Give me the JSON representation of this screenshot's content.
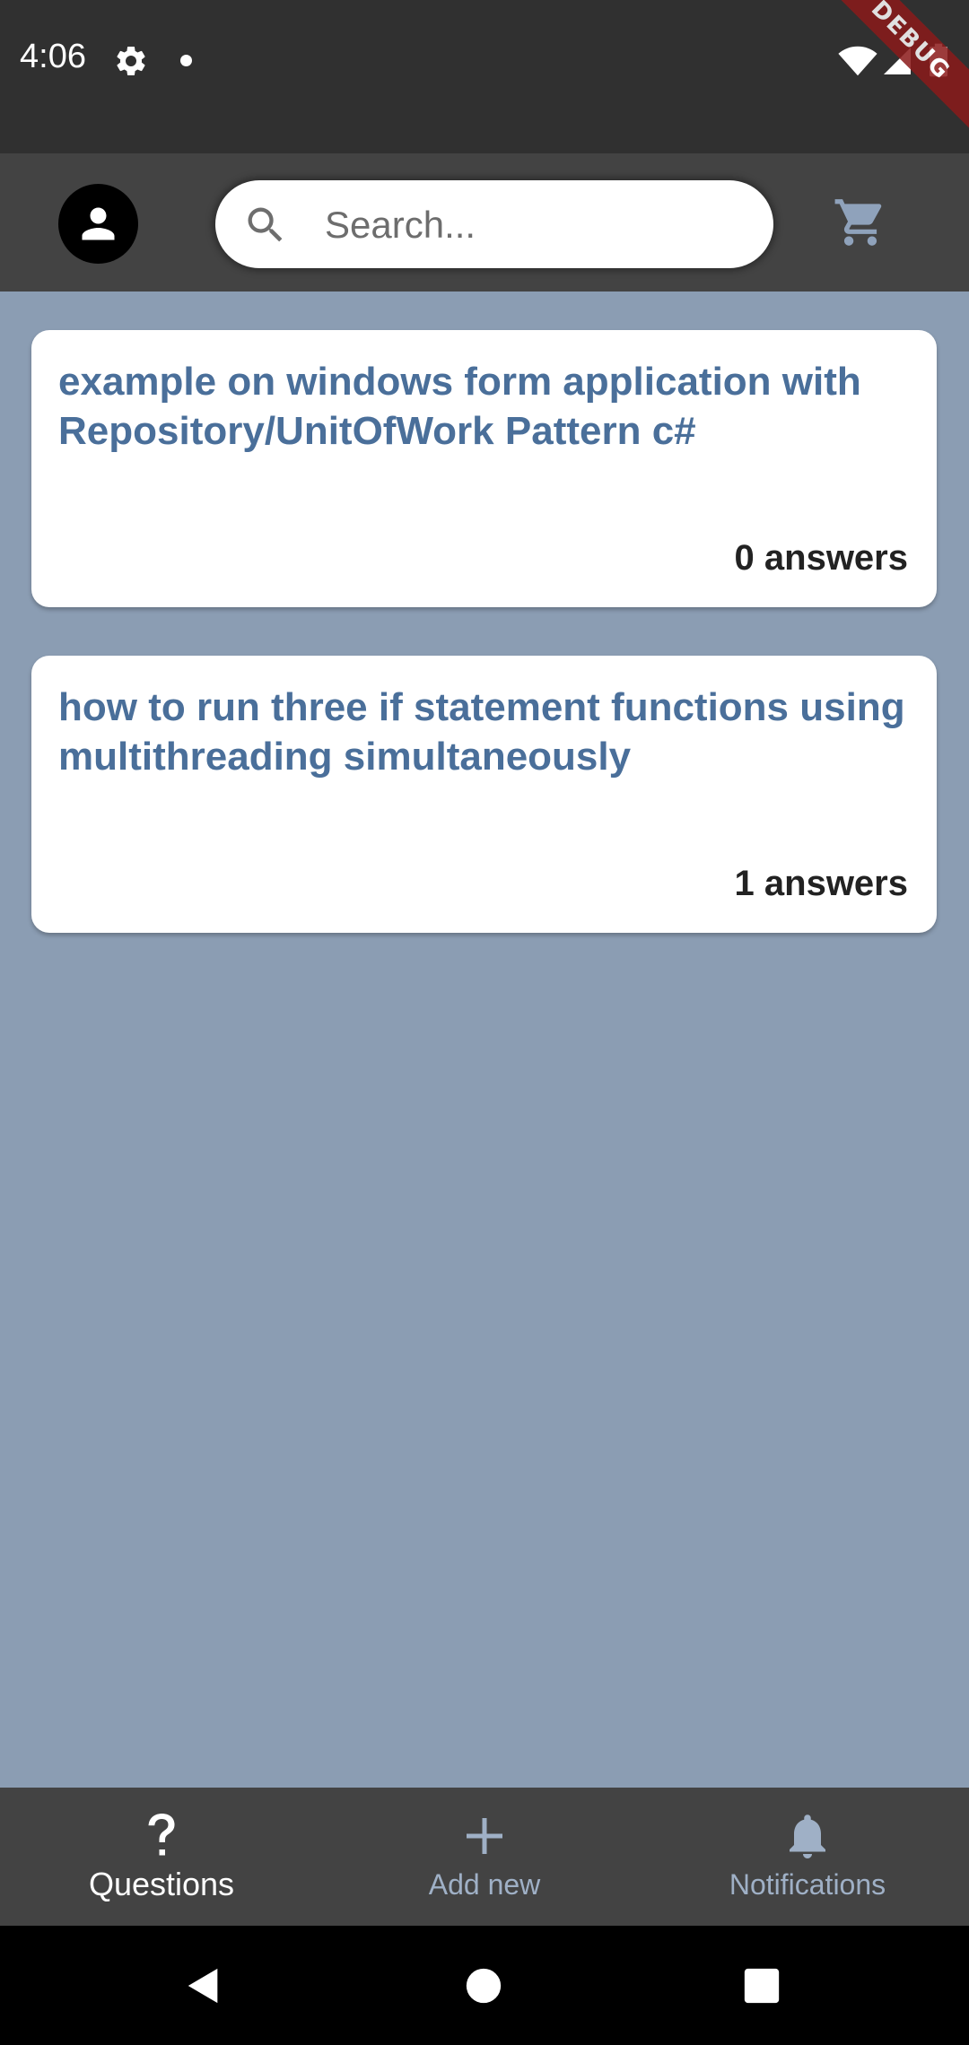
{
  "status_bar": {
    "time": "4:06",
    "debug_banner": "DEBUG"
  },
  "app_bar": {
    "search": {
      "placeholder": "Search..."
    }
  },
  "questions": [
    {
      "title": "example on windows form application with Repository/UnitOfWork Pattern c#",
      "answers": "0 answers"
    },
    {
      "title": "how to run three if statement functions using multithreading simultaneously",
      "answers": "1 answers"
    }
  ],
  "bottom_nav": {
    "items": [
      {
        "label": "Questions",
        "icon": "question-icon",
        "active": true
      },
      {
        "label": "Add new",
        "icon": "plus-icon",
        "active": false
      },
      {
        "label": "Notifications",
        "icon": "bell-icon",
        "active": false
      }
    ]
  },
  "colors": {
    "background": "#8b9db3",
    "app_bar": "#434343",
    "status_bar": "#303030",
    "card_title": "#4a6f9a",
    "inactive_nav": "#9fb0c6"
  }
}
